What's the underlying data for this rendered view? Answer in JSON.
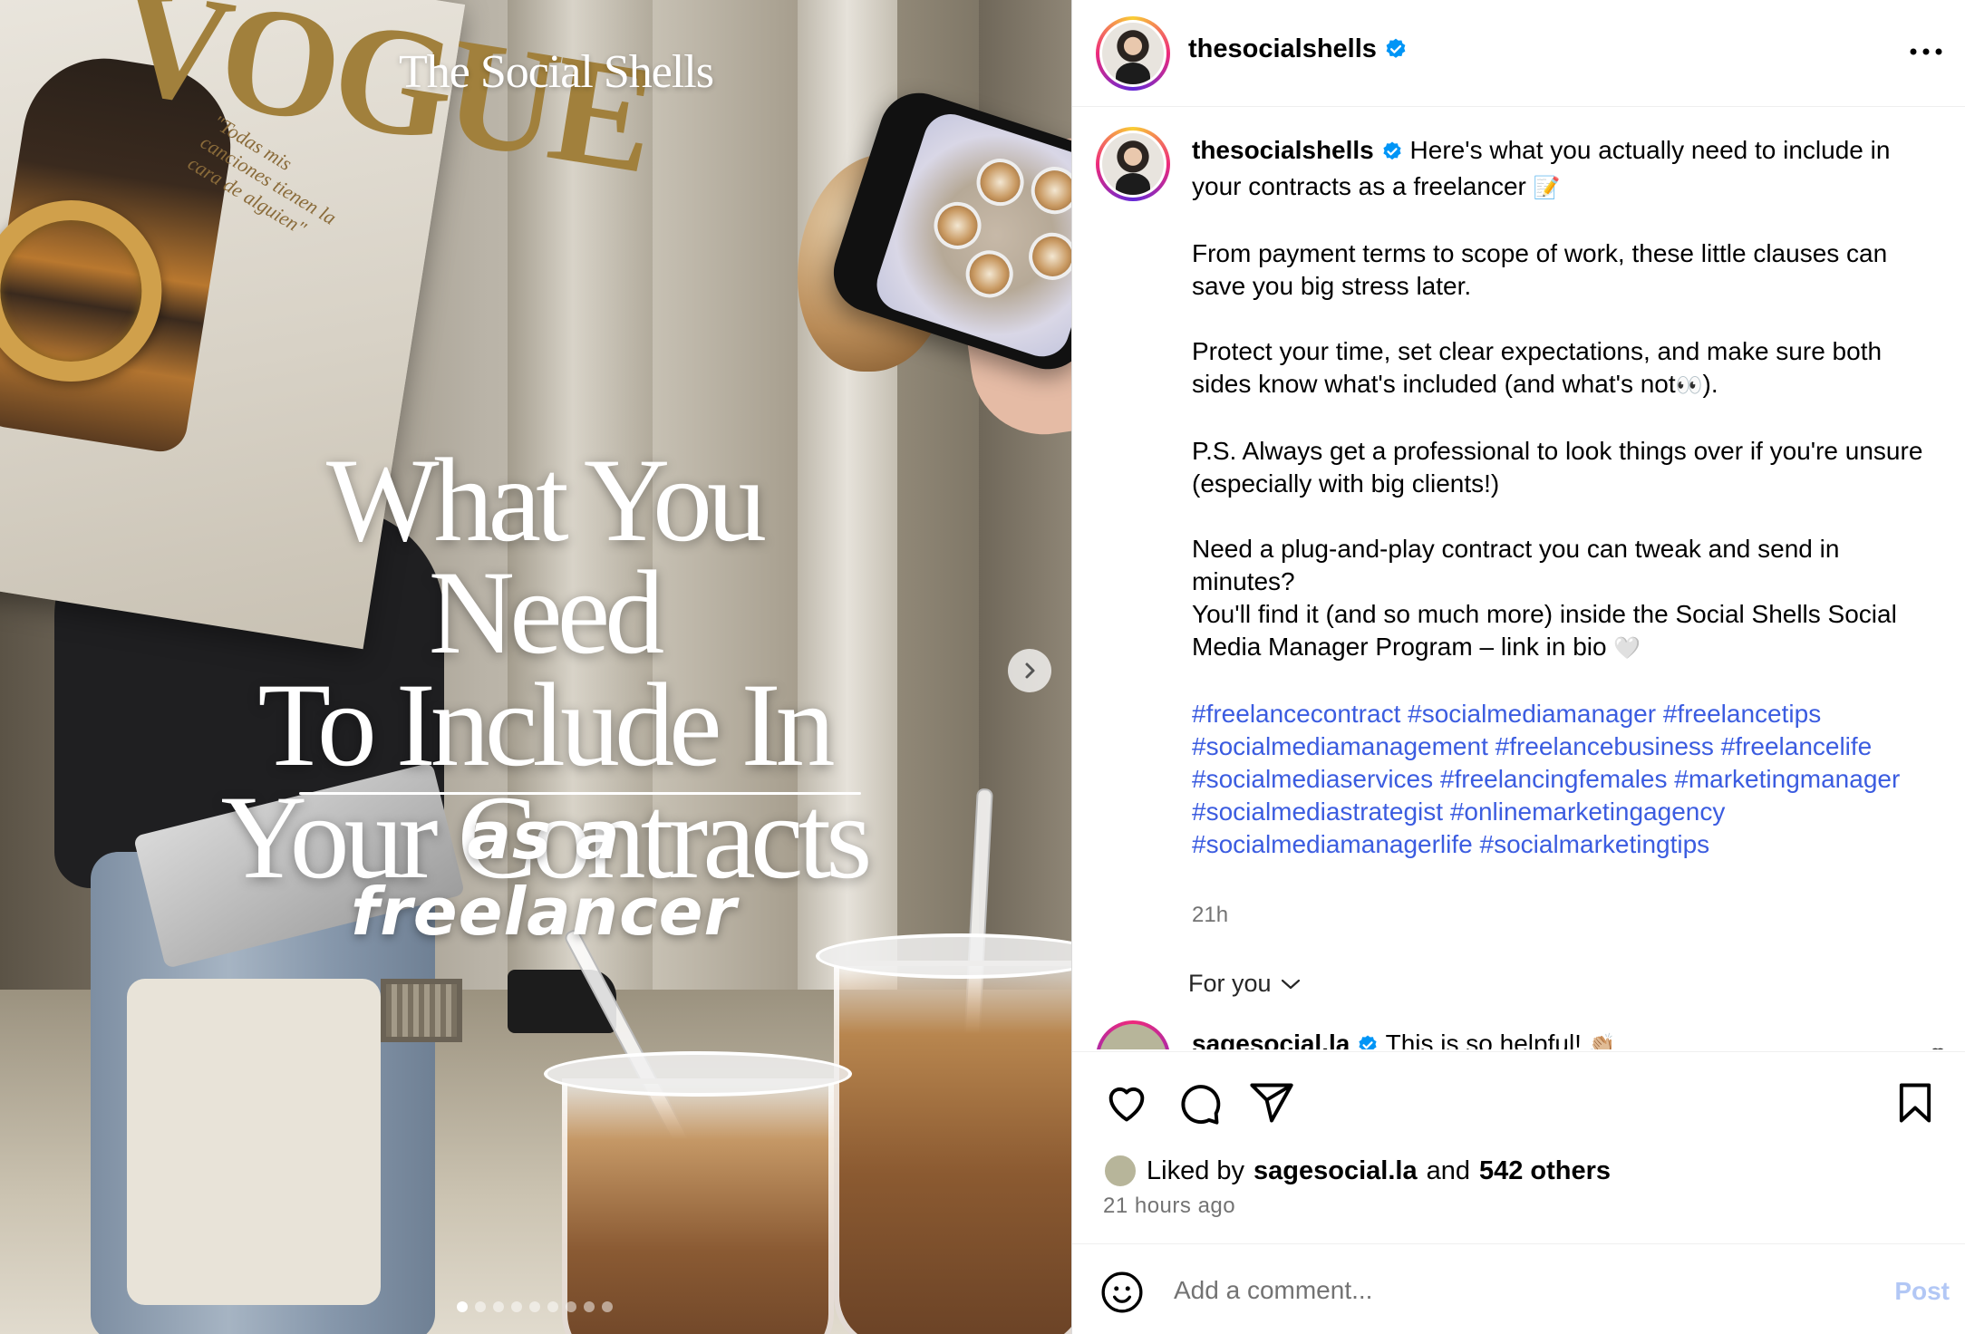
{
  "media": {
    "brand_text": "The Social Shells",
    "headline_lines": [
      "What You Need",
      "To Include In",
      "Your Contracts"
    ],
    "subheadline": "as a freelancer",
    "magazine_title": "VOGUE",
    "magazine_quote": "\"Todas mis canciones tienen la cara de alguien\"",
    "carousel": {
      "total": 9,
      "active_index": 0
    },
    "next_icon": "chevron-right-icon"
  },
  "header": {
    "username": "thesocialshells",
    "verified": true,
    "more_icon": "more-horizontal-icon"
  },
  "caption": {
    "username": "thesocialshells",
    "intro": "Here's what you actually need to include in your contracts as a freelancer",
    "intro_emoji": "📝",
    "paragraphs": [
      "From payment terms to scope of work, these little clauses can save you big stress later.",
      "Protect your time, set clear expectations, and make sure both sides know what's included (and what's not",
      "P.S. Always get a professional to look things over if you're unsure (especially with big clients!)"
    ],
    "eyes_emoji": "👀",
    "para2_end": ").",
    "cta_line1": "Need a plug-and-play contract you can tweak and send in minutes?",
    "cta_line2": "You'll find it (and so much more) inside the Social Shells Social Media Manager Program – link in bio",
    "cta_emoji": "🤍",
    "hashtags": [
      "#freelancecontract",
      "#socialmediamanager",
      "#freelancetips",
      "#socialmediamanagement",
      "#freelancebusiness",
      "#freelancelife",
      "#socialmediaservices",
      "#freelancingfemales",
      "#marketingmanager",
      "#socialmediastrategist",
      "#onlinemarketingagency",
      "#socialmediamanagerlife",
      "#socialmarketingtips"
    ],
    "age": "21h"
  },
  "for_you": {
    "label": "For you",
    "icon": "chevron-down-icon"
  },
  "top_comment": {
    "username": "sagesocial.la",
    "verified": true,
    "text": "This is so helpful!",
    "emoji": "👏🏼"
  },
  "actions": {
    "like_icon": "heart-icon",
    "comment_icon": "comment-icon",
    "share_icon": "send-icon",
    "save_icon": "bookmark-icon"
  },
  "likes": {
    "prefix": "Liked by",
    "user": "sagesocial.la",
    "joiner": "and",
    "others": "542 others"
  },
  "timestamp": "21 hours ago",
  "comment_box": {
    "placeholder": "Add a comment...",
    "post_label": "Post",
    "emoji_icon": "smiley-icon"
  },
  "colors": {
    "link_blue": "#3b5ce0",
    "verified_blue": "#0095f6",
    "post_disabled": "#b2c7f5"
  }
}
